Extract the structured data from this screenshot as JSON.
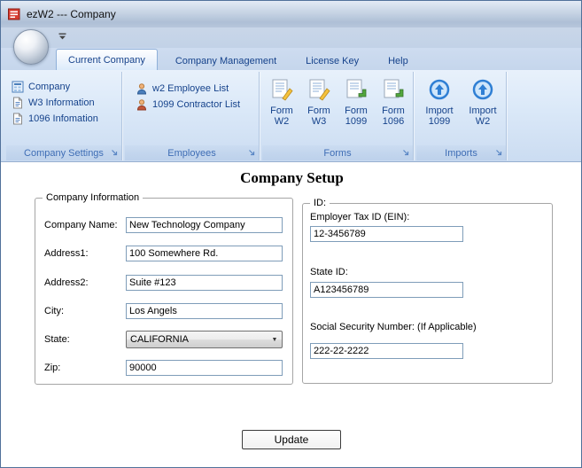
{
  "window": {
    "title": "ezW2 --- Company"
  },
  "colors": {
    "ribbon_text": "#15428b",
    "group_caption_text": "#3e6db5",
    "ribbon_bg_top": "#e8f1fb",
    "ribbon_bg_bottom": "#cbdcf1",
    "input_border": "#7f9db9",
    "app_icon_red": "#d83b2f"
  },
  "icons": {
    "app": "red-form-icon",
    "quick_access": "chevron-down-icon",
    "orb": "application-orb",
    "company": "building-icon",
    "w3_information": "document-icon",
    "info_1096": "document-icon",
    "employee_list": "person-icon",
    "contractor_list": "person-icon",
    "form_w2": "form-pencil-icon",
    "form_w3": "form-pencil-icon",
    "form_1099": "form-arrow-icon",
    "form_1096": "form-arrow-icon",
    "import": "import-circle-icon",
    "dialog_launcher": "launcher-arrow-icon",
    "state_dropdown": "chevron-down-icon"
  },
  "ribbon": {
    "tabs": [
      {
        "label": "Current Company"
      },
      {
        "label": "Company Management"
      },
      {
        "label": "License Key"
      },
      {
        "label": "Help"
      }
    ],
    "company_settings": {
      "caption": "Company Settings",
      "items": [
        {
          "label": "Company"
        },
        {
          "label": "W3 Information"
        },
        {
          "label": "1096 Infomation"
        }
      ]
    },
    "employees": {
      "caption": "Employees",
      "items": [
        {
          "label": "w2 Employee List"
        },
        {
          "label": "1099 Contractor List"
        }
      ]
    },
    "forms": {
      "caption": "Forms",
      "items": [
        {
          "line1": "Form",
          "line2": "W2"
        },
        {
          "line1": "Form",
          "line2": "W3"
        },
        {
          "line1": "Form",
          "line2": "1099"
        },
        {
          "line1": "Form",
          "line2": "1096"
        }
      ]
    },
    "imports": {
      "caption": "Imports",
      "items": [
        {
          "line1": "Import",
          "line2": "1099"
        },
        {
          "line1": "Import",
          "line2": "W2"
        }
      ]
    }
  },
  "main": {
    "title": "Company Setup",
    "company_info": {
      "legend": "Company Information",
      "fields": [
        {
          "label": "Company Name:",
          "value": "New Technology Company"
        },
        {
          "label": "Address1:",
          "value": "100 Somewhere Rd."
        },
        {
          "label": "Address2:",
          "value": "Suite #123"
        },
        {
          "label": "City:",
          "value": "Los Angels"
        },
        {
          "label": "State:",
          "value": "CALIFORNIA"
        },
        {
          "label": "Zip:",
          "value": "90000"
        }
      ]
    },
    "ids": {
      "legend": "ID:",
      "fields": [
        {
          "label": "Employer Tax ID (EIN):",
          "value": "12-3456789"
        },
        {
          "label": "State ID:",
          "value": "A123456789"
        },
        {
          "label": "Social Security Number: (If Applicable)",
          "value": "222-22-2222"
        }
      ]
    },
    "update_button": "Update"
  }
}
